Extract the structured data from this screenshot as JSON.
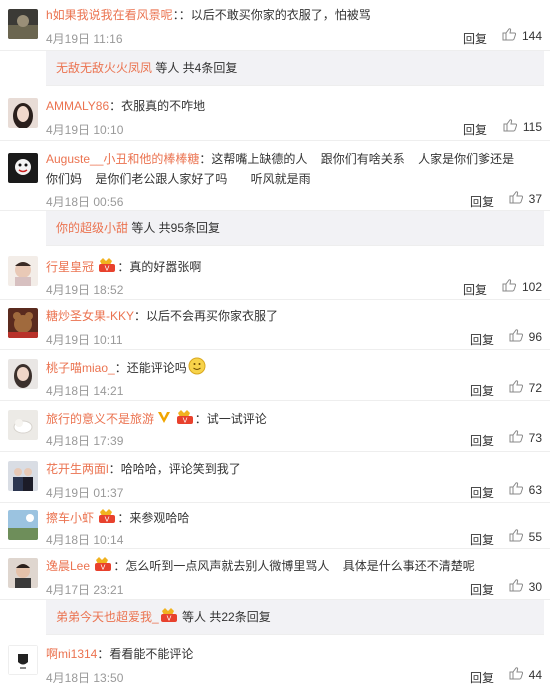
{
  "comments": [
    {
      "user": "h如果我说我在看风景呢",
      "sep": "：",
      "text": "：以后不敢买你家的衣服了，怕被骂",
      "time": "4月19日 11:16",
      "reply": "回复",
      "likes": "144"
    },
    {
      "user": "AMMALY86",
      "sep": "：",
      "text": "衣服真的不咋地",
      "time": "4月19日 10:10",
      "reply": "回复",
      "likes": "115"
    },
    {
      "user": "Auguste__小丑和他的棒棒糖",
      "sep": "：",
      "text": "这帮嘴上缺德的人    跟你们有啥关系    人家是你们爹还是你们妈    是你们老公跟人家好了吗       听风就是雨",
      "time": "4月18日 00:56",
      "reply": "回复",
      "likes": "37"
    },
    {
      "user": "行星皇冠",
      "sep": "：",
      "text": "真的好嚣张啊",
      "time": "4月19日 18:52",
      "reply": "回复",
      "likes": "102"
    },
    {
      "user": "糖炒圣女果-KKY",
      "sep": "：",
      "text": "以后不会再买你家衣服了",
      "time": "4月19日 10:11",
      "reply": "回复",
      "likes": "96"
    },
    {
      "user": "桃子喵miao_",
      "sep": "：",
      "text": "还能评论吗",
      "time": "4月18日 14:21",
      "reply": "回复",
      "likes": "72"
    },
    {
      "user": "旅行的意义不是旅游",
      "sep": "：",
      "text": "试一试评论",
      "time": "4月18日 17:39",
      "reply": "回复",
      "likes": "73"
    },
    {
      "user": "花开生两面l",
      "sep": "：",
      "text": "哈哈哈，评论笑到我了",
      "time": "4月19日 01:37",
      "reply": "回复",
      "likes": "63"
    },
    {
      "user": "擦车小虾",
      "sep": "：",
      "text": "来参观哈哈",
      "time": "4月18日 10:14",
      "reply": "回复",
      "likes": "55"
    },
    {
      "user": "逸晨Lee",
      "sep": "：",
      "text": "怎么听到一点风声就去别人微博里骂人    具体是什么事还不清楚呢",
      "time": "4月17日 23:21",
      "reply": "回复",
      "likes": "30"
    },
    {
      "user": "啊mi1314",
      "sep": "：",
      "text": "看看能不能评论",
      "time": "4月18日 13:50",
      "reply": "回复",
      "likes": "44"
    }
  ],
  "subs": [
    {
      "user": "无敌无敌火火凤凤",
      "suffix": " 等人  共4条回复"
    },
    {
      "user": "你的超级小甜",
      "suffix": " 等人  共95条回复"
    },
    {
      "user": "弟弟今天也超爱我_",
      "suffix": " 等人  共22条回复"
    }
  ],
  "colors": {
    "name": "#eb7350",
    "sub_bg": "#f2f2f5",
    "meta": "#999999"
  },
  "icons": {
    "like": "thumbs-up-icon",
    "vip": "vip-badge-icon",
    "verified": "v-verified-icon",
    "emoji": "smile-emoji-icon"
  }
}
